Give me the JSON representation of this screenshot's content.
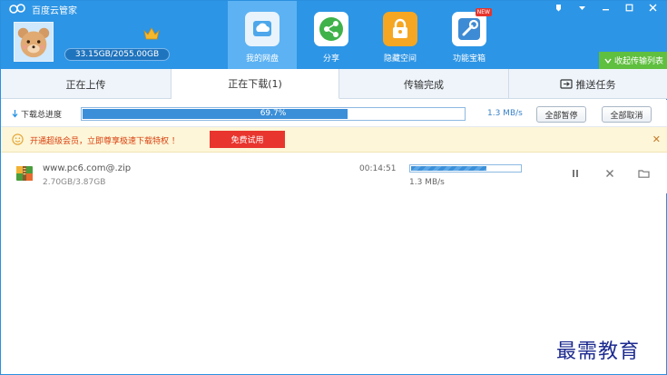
{
  "app": {
    "title": "百度云管家"
  },
  "account": {
    "quota": "33.15GB/2055.00GB"
  },
  "nav": [
    {
      "label": "我的网盘",
      "icon": "cloud-icon",
      "active": true
    },
    {
      "label": "分享",
      "icon": "share-icon",
      "active": false
    },
    {
      "label": "隐藏空间",
      "icon": "lock-icon",
      "active": false
    },
    {
      "label": "功能宝箱",
      "icon": "tools-icon",
      "active": false,
      "badge": "NEW"
    }
  ],
  "header": {
    "transfer_list_label": "收起传输列表"
  },
  "tabs": [
    {
      "label": "正在上传",
      "active": false
    },
    {
      "label": "正在下载(1)",
      "active": true
    },
    {
      "label": "传输完成",
      "active": false
    },
    {
      "label": "推送任务",
      "active": false
    }
  ],
  "progress": {
    "label": "下载总进度",
    "percent": 69.7,
    "percent_text": "69.7%",
    "speed": "1.3 MB/s",
    "pause_all": "全部暂停",
    "cancel_all": "全部取消"
  },
  "promo": {
    "text": "开通超级会员，立即尊享极速下载特权 ！",
    "button": "免费试用"
  },
  "downloads": [
    {
      "name": "www.pc6.com@.zip",
      "size": "2.70GB/3.87GB",
      "time_left": "00:14:51",
      "progress": 0.698,
      "speed": "1.3 MB/s"
    }
  ],
  "watermark": "最需教育",
  "colors": {
    "header": "#2d95e5",
    "accent": "#3b8fd8",
    "promo_button": "#e8362e",
    "transfer_button": "#5fbf3f"
  }
}
